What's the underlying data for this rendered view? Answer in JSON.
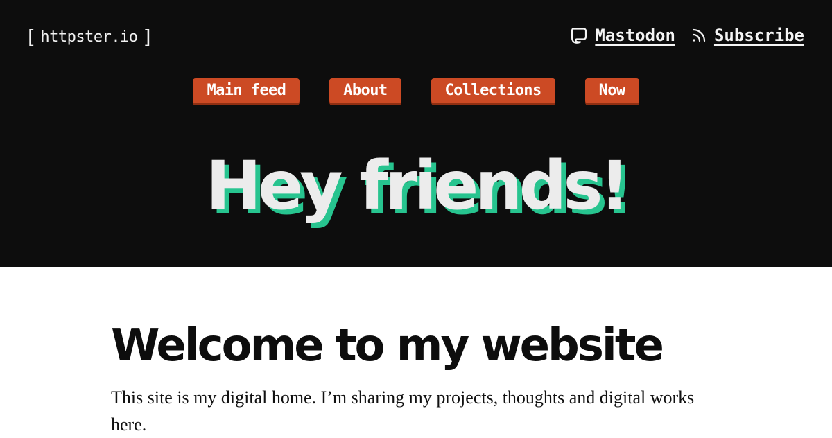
{
  "site": {
    "logo_name": "httpster.io",
    "logo_bracket_left": "[",
    "logo_bracket_right": "]"
  },
  "top_links": [
    {
      "label": "Mastodon",
      "icon": "mastodon-icon"
    },
    {
      "label": "Subscribe",
      "icon": "rss-icon"
    }
  ],
  "nav": {
    "items": [
      {
        "label": "Main feed"
      },
      {
        "label": "About"
      },
      {
        "label": "Collections"
      },
      {
        "label": "Now"
      }
    ]
  },
  "hero": {
    "heading": "Hey friends!"
  },
  "main": {
    "heading": "Welcome to my website",
    "intro": "This site is my digital home. I’m sharing my projects, thoughts and digital works here."
  },
  "colors": {
    "header_bg": "#0d0d0d",
    "nav_button_bg": "#cc4a24",
    "hero_shadow": "#27c48f",
    "page_bg": "#ffffff"
  }
}
